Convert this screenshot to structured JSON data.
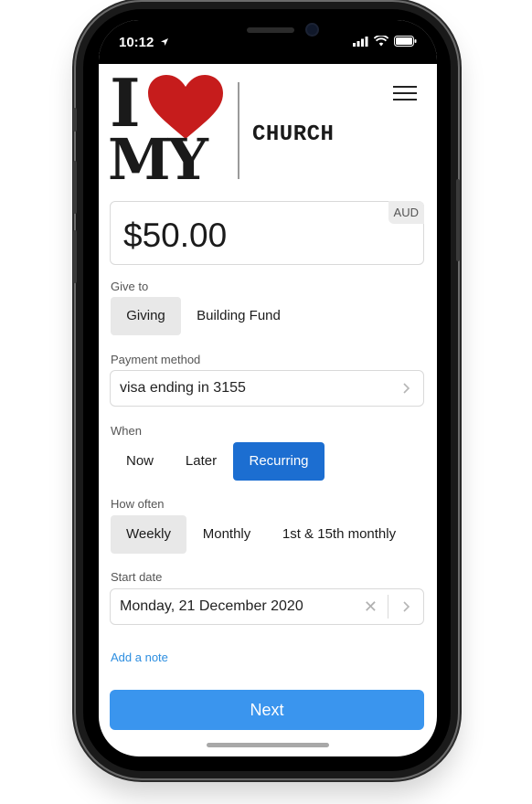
{
  "status": {
    "time": "10:12"
  },
  "header": {
    "logo_top": "I",
    "logo_bottom": "MY",
    "org_name": "CHURCH"
  },
  "amount": {
    "value": "$50.00",
    "currency": "AUD"
  },
  "give_to": {
    "label": "Give to",
    "options": [
      "Giving",
      "Building Fund"
    ],
    "selected": "Giving"
  },
  "payment": {
    "label": "Payment method",
    "value": "visa ending in 3155"
  },
  "when": {
    "label": "When",
    "options": [
      "Now",
      "Later",
      "Recurring"
    ],
    "selected": "Recurring"
  },
  "how_often": {
    "label": "How often",
    "options": [
      "Weekly",
      "Monthly",
      "1st & 15th monthly"
    ],
    "selected": "Weekly"
  },
  "start_date": {
    "label": "Start date",
    "value": "Monday, 21 December 2020"
  },
  "note_link": "Add a note",
  "next_label": "Next",
  "colors": {
    "primary": "#1c6ed1",
    "next": "#3a95ee",
    "heart": "#c61c1c"
  }
}
